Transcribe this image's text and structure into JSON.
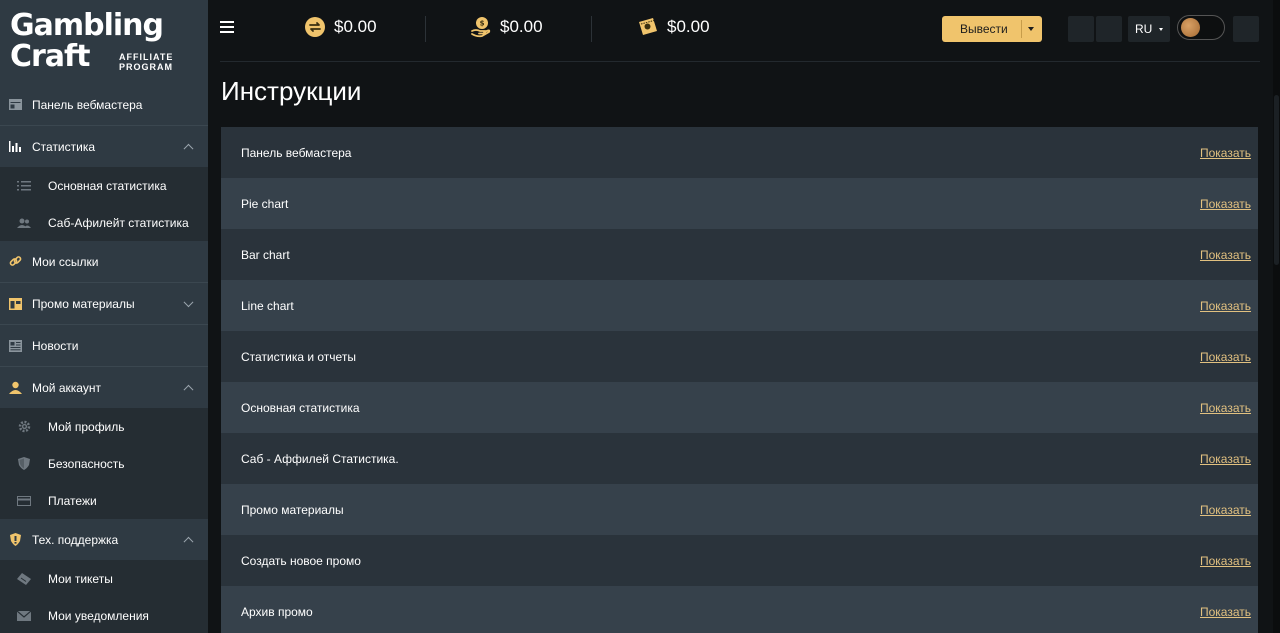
{
  "logo": {
    "line1": "Gambling",
    "line2": "Craft",
    "tag_line1": "AFFILIATE",
    "tag_line2": "PROGRAM"
  },
  "sidebar": {
    "items": [
      {
        "label": "Панель вебмастера"
      },
      {
        "label": "Статистика"
      },
      {
        "label": "Основная статистика"
      },
      {
        "label": "Саб-Афилейт статистика"
      },
      {
        "label": "Мои ссылки"
      },
      {
        "label": "Промо материалы"
      },
      {
        "label": "Новости"
      },
      {
        "label": "Мой аккаунт"
      },
      {
        "label": "Мой профиль"
      },
      {
        "label": "Безопасность"
      },
      {
        "label": "Платежи"
      },
      {
        "label": "Тех. поддержка"
      },
      {
        "label": "Мои тикеты"
      },
      {
        "label": "Мои уведомления"
      }
    ]
  },
  "header": {
    "balances": [
      {
        "value": "$0.00"
      },
      {
        "value": "$0.00"
      },
      {
        "value": "$0.00"
      }
    ],
    "withdraw_label": "Вывести",
    "language": "RU"
  },
  "main": {
    "title": "Инструкции",
    "show_label": "Показать",
    "rows": [
      {
        "label": "Панель вебмастера"
      },
      {
        "label": "Pie chart"
      },
      {
        "label": "Bar chart"
      },
      {
        "label": "Line chart"
      },
      {
        "label": "Статистика и отчеты"
      },
      {
        "label": "Основная статистика"
      },
      {
        "label": "Саб - Аффилей Статистика."
      },
      {
        "label": "Промо материалы"
      },
      {
        "label": "Создать новое промо"
      },
      {
        "label": "Архив промо"
      }
    ]
  },
  "colors": {
    "accent": "#f0c46c",
    "link": "#e2c180",
    "sidebar": "#2f3a43",
    "row_dark": "#2a333b",
    "row_light": "#36414b"
  }
}
